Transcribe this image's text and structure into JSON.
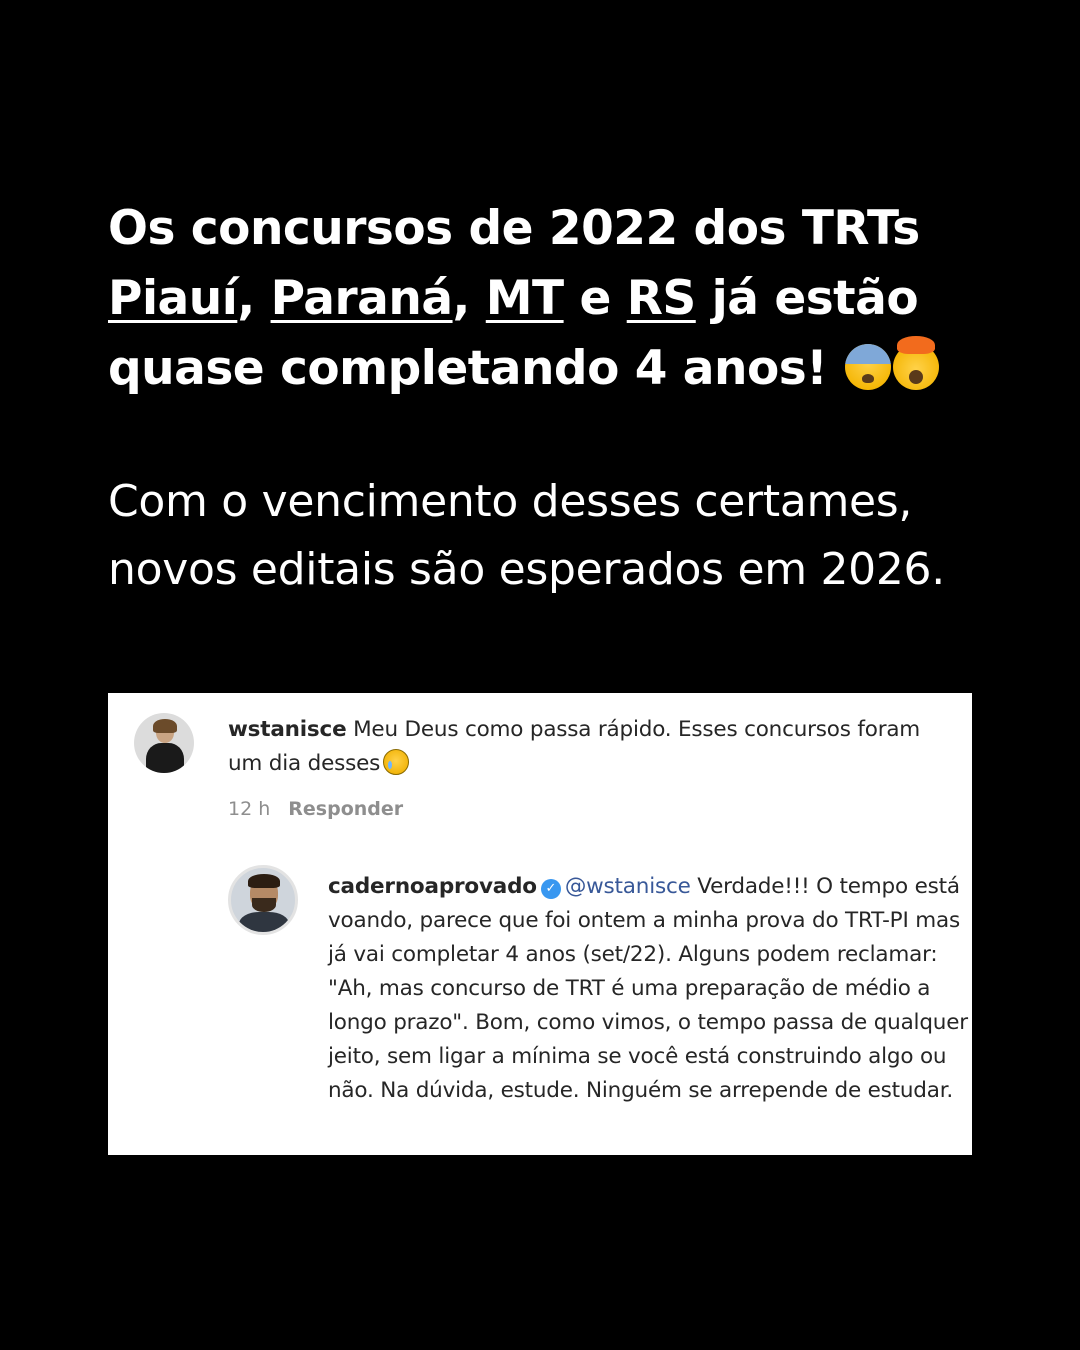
{
  "headline": {
    "line1": "Os concursos de 2022 dos TRTs",
    "states": [
      "Piauí",
      "Paraná",
      "MT",
      "RS"
    ],
    "sep1": ", ",
    "sep2": ", ",
    "sep3": " e ",
    "line2_suffix": " já estão",
    "line3": "quase completando 4 anos! ",
    "emojis": [
      "anxious-face-icon",
      "exploding-head-icon"
    ]
  },
  "subtext": {
    "line1": "Com o vencimento desses certames,",
    "line2": "novos editais são esperados em 2026."
  },
  "comments": [
    {
      "username": "wstanisce",
      "text": " Meu Deus como passa rápido. Esses concursos foram um dia desses",
      "emoji": "crying-face-icon",
      "time": "12 h",
      "reply_label": "Responder"
    },
    {
      "username": "cadernoaprovado",
      "verified": true,
      "mention": "@wstanisce",
      "text": " Verdade!!! O tempo está voando, parece que foi ontem a minha prova do TRT-PI mas já vai completar 4 anos (set/22). Alguns podem reclamar: \"Ah, mas concurso de TRT é uma preparação de médio a longo prazo\". Bom, como vimos, o tempo passa de qualquer jeito, sem ligar a mínima se você está construindo algo ou não. Na dúvida, estude. Ninguém se arrepende de estudar."
    }
  ],
  "colors": {
    "background": "#000000",
    "text": "#ffffff",
    "card": "#ffffff",
    "comment_text": "#262626",
    "meta": "#8e8e8e",
    "mention": "#385898",
    "verified": "#3897f0"
  }
}
